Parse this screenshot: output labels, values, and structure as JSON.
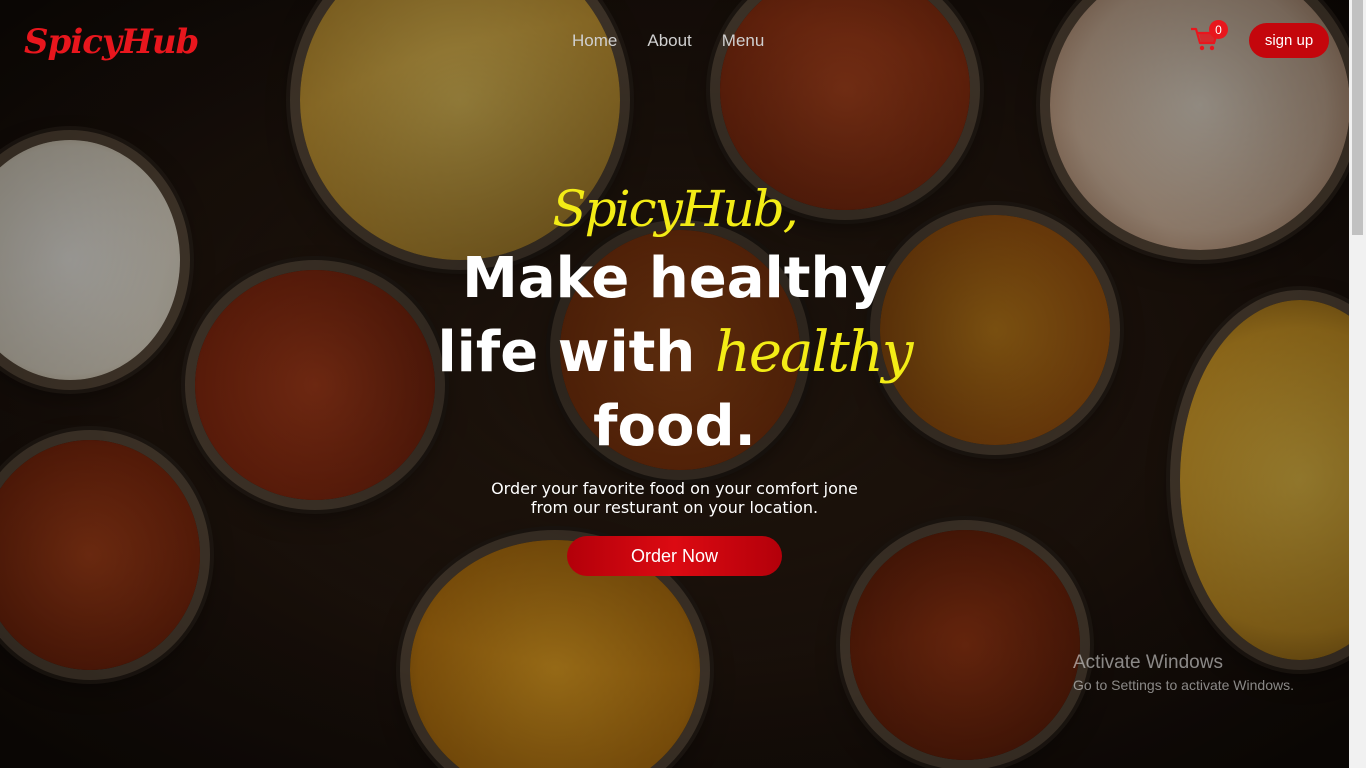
{
  "brand": {
    "logo": "SpicyHub"
  },
  "nav": {
    "items": [
      "Home",
      "About",
      "Menu"
    ]
  },
  "cart": {
    "count": "0",
    "icon": "cart-icon"
  },
  "auth": {
    "signup_label": "sign up"
  },
  "hero": {
    "brand_line": "SpicyHub,",
    "line1": "Make healthy",
    "line2_plain": "life with ",
    "line2_highlight": "healthy",
    "line3": "food.",
    "sub_line1": "Order your favorite food on your comfort jone",
    "sub_line2": "from our resturant on your location.",
    "cta_label": "Order Now"
  },
  "watermark": {
    "title": "Activate Windows",
    "subtitle": "Go to Settings to activate Windows."
  },
  "colors": {
    "brand_red": "#e8161d",
    "button_red": "#c4060c",
    "highlight_yellow": "#f3ec16"
  }
}
